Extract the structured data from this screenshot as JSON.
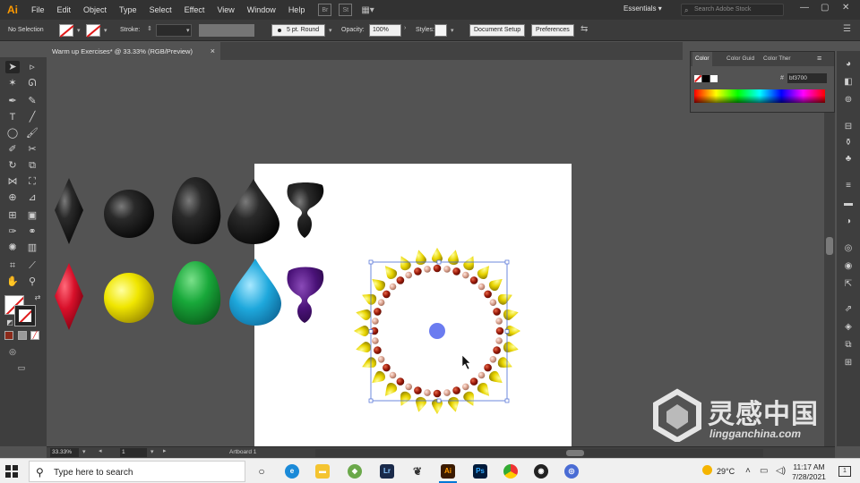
{
  "app": {
    "logo": "Ai"
  },
  "menu": [
    "File",
    "Edit",
    "Object",
    "Type",
    "Select",
    "Effect",
    "View",
    "Window",
    "Help"
  ],
  "menu_bar": {
    "bridge": "Br",
    "stock": "St",
    "workspace": "Essentials",
    "search_placeholder": "Search Adobe Stock"
  },
  "control_bar": {
    "selection": "No Selection",
    "stroke_label": "Stroke:",
    "brush": "5 pt. Round",
    "opacity_label": "Opacity:",
    "opacity": "100%",
    "styles_label": "Styles:",
    "document_setup": "Document Setup",
    "preferences": "Preferences"
  },
  "document": {
    "tab_title": "Warm up Exercises* @ 33.33% (RGB/Preview)",
    "close": "×"
  },
  "status": {
    "zoom": "33.33%",
    "artboard_number": "1",
    "artboard_label": "Artboard 1"
  },
  "color_panel": {
    "tabs": [
      "Color",
      "Color Guid",
      "Color Ther"
    ],
    "hex": "bf3700",
    "hash": "#"
  },
  "colors": {
    "accent_selection": "#4a6cd4",
    "bead_brown": "#8b1a0a",
    "bead_pink": "#d9a08c",
    "spike_yellow": "#e8d400",
    "center_dot": "#6b7cf0"
  },
  "shapes": {
    "top_row": [
      "black-diamond",
      "black-sphere",
      "black-egg",
      "black-drop",
      "black-vase"
    ],
    "bottom_row": [
      "red-diamond",
      "yellow-sphere",
      "green-egg",
      "blue-drop",
      "purple-vase"
    ]
  },
  "watermark": {
    "title": "灵感中国",
    "subtitle": "lingganchina.com"
  },
  "taskbar": {
    "search_placeholder": "Type here to search",
    "temperature": "29°C",
    "time": "11:17 AM",
    "date": "7/28/2021",
    "apps": [
      "task-view",
      "edge",
      "file-explorer",
      "app-green",
      "lightroom",
      "app-bird",
      "illustrator",
      "photoshop",
      "chrome",
      "obs",
      "chrome-alt"
    ]
  }
}
